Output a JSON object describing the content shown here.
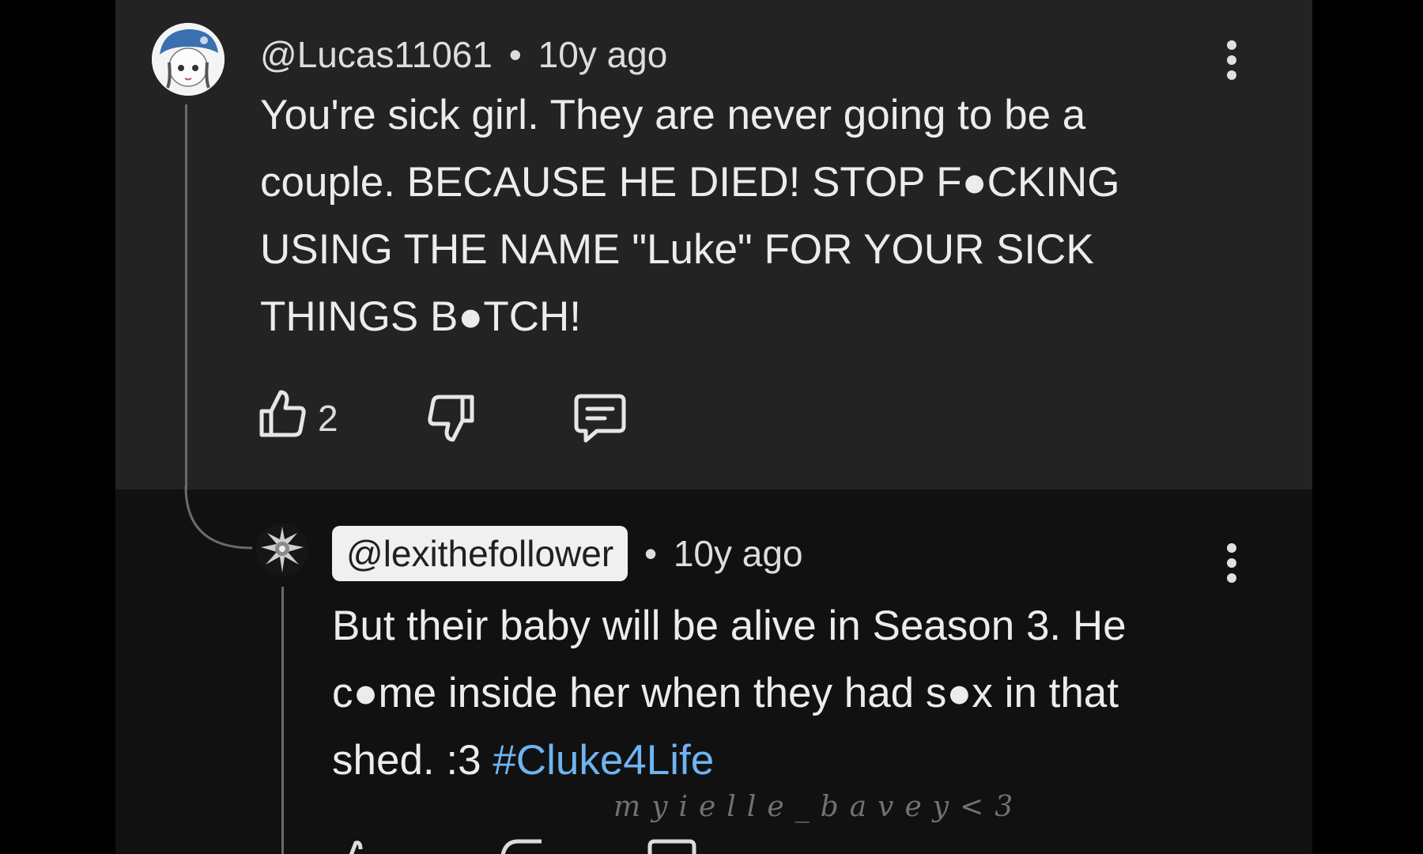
{
  "comment": {
    "handle": "@Lucas11061",
    "time": "10y ago",
    "separator": "•",
    "lines": [
      "You're sick girl. They are never going to be a",
      "couple. BECAUSE HE DIED! STOP F●CKING",
      "USING THE NAME \"Luke\" FOR YOUR SICK",
      "THINGS B●TCH!"
    ],
    "like_count": "2"
  },
  "reply": {
    "handle": "@lexithefollower",
    "time": "10y ago",
    "separator": "•",
    "lines": [
      "But their baby will be alive in Season 3. He",
      "c●me inside her when they had s●x in that"
    ],
    "last_line_text": "shed. :3",
    "hashtag": "#Cluke4Life"
  },
  "watermark": "myielle_bavey<3",
  "colors": {
    "comment_bg": "#232323",
    "reply_bg": "#111111",
    "hashtag": "#6fb4f0"
  },
  "icons": [
    "thumbs-up-icon",
    "thumbs-down-icon",
    "reply-icon",
    "more-vert-icon"
  ]
}
